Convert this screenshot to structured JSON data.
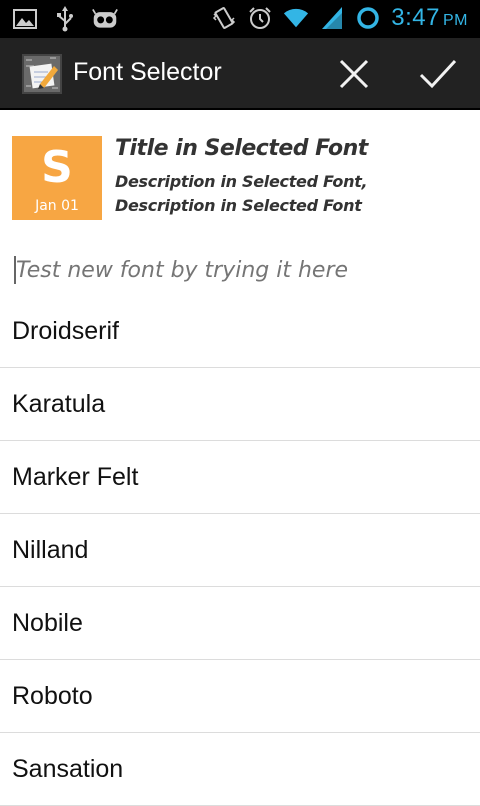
{
  "status_bar": {
    "time": "3:47",
    "ampm": "PM",
    "icons": [
      "image-icon",
      "usb-icon",
      "android-icon",
      "vibrate-icon",
      "alarm-icon",
      "wifi-icon",
      "signal-icon",
      "sync-icon"
    ],
    "accent_color": "#33b5e5"
  },
  "action_bar": {
    "title": "Font Selector",
    "icons": [
      "notebook-icon",
      "close-icon",
      "check-icon"
    ]
  },
  "preview": {
    "badge_letter": "S",
    "badge_date": "Jan 01",
    "badge_color": "#f7a643",
    "title": "Title in Selected Font",
    "description": "Description in Selected Font, Description in Selected Font"
  },
  "test_field": {
    "placeholder": "Test new font by trying it here"
  },
  "fonts": [
    "Droidserif",
    "Karatula",
    "Marker Felt",
    "Nilland",
    "Nobile",
    "Roboto",
    "Sansation"
  ]
}
